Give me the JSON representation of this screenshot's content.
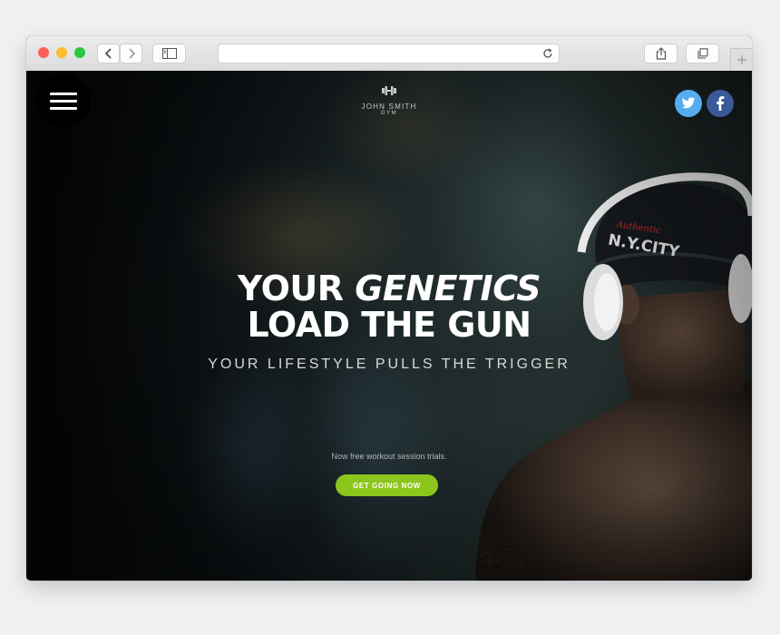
{
  "browser": {
    "window_controls": [
      "close",
      "minimize",
      "zoom"
    ],
    "back_icon": "chevron-left-icon",
    "forward_icon": "chevron-right-icon",
    "sidebar_icon": "sidebar-icon",
    "reload_icon": "reload-icon",
    "share_icon": "share-icon",
    "tabs_icon": "tabs-icon",
    "new_tab_icon": "plus-icon",
    "url": ""
  },
  "site": {
    "menu_icon": "hamburger-menu-icon",
    "logo": {
      "icon": "dumbbell-icon",
      "name": "JOHN SMITH",
      "sub": "GYM"
    },
    "social": [
      {
        "name": "twitter",
        "icon": "twitter-icon",
        "color": "#55acee"
      },
      {
        "name": "facebook",
        "icon": "facebook-icon",
        "color": "#3b5998"
      }
    ],
    "hero": {
      "headline_line1_plain": "YOUR ",
      "headline_line1_accent": "GENETICS",
      "headline_line2": "LOAD THE GUN",
      "tagline": "YOUR LIFESTYLE PULLS THE TRIGGER",
      "note": "Now free workout session trials.",
      "cta_label": "GET GOING NOW",
      "cta_color": "#8cc51b"
    }
  }
}
